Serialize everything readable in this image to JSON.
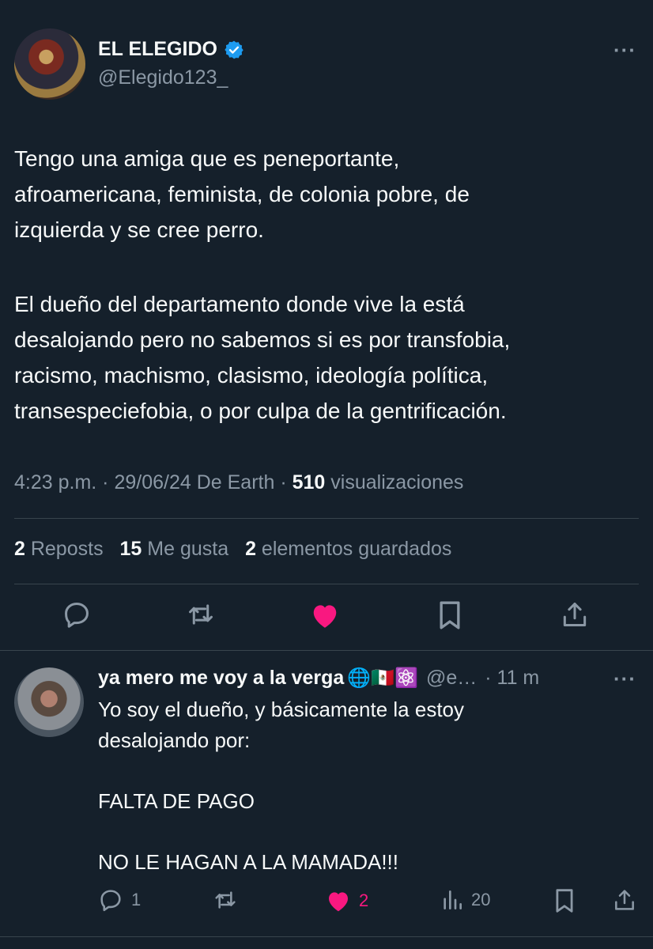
{
  "post": {
    "author_name": "EL ELEGIDO",
    "author_handle": "@Elegido123_",
    "more_label": "···",
    "paragraph_1": "Tengo una amiga que es peneportante,\nafroamericana, feminista, de colonia pobre, de\nizquierda y se cree perro.",
    "paragraph_2": "El dueño del departamento donde vive la está\ndesalojando pero no sabemos si es por transfobia,\nracismo, machismo, clasismo, ideología política,\ntransespeciefobia, o por culpa de la gentrificación.",
    "meta": {
      "time": "4:23 p.m.",
      "sep1": " · ",
      "date": "29/06/24",
      "source": " De Earth",
      "sep2": " · ",
      "views_count": "510",
      "views_label": " visualizaciones"
    },
    "stats": {
      "reposts_count": "2",
      "reposts_label": " Reposts",
      "likes_count": "15",
      "likes_label": " Me gusta",
      "bookmarks_count": "2",
      "bookmarks_label": " elementos guardados"
    },
    "actions": [
      "reply-icon",
      "repost-icon",
      "like-icon-filled",
      "bookmark-icon",
      "share-icon"
    ],
    "like_color": "#f91880"
  },
  "reply": {
    "author_name": "ya mero me voy a la verga",
    "emoji": "🌐🇲🇽⚛️",
    "handle_truncated": "@e…",
    "time": "· 11 m",
    "more_label": "···",
    "text": "Yo soy el dueño, y básicamente la estoy\ndesalojando por:\n\nFALTA DE PAGO\n\nNO LE HAGAN A LA MAMADA!!!",
    "counts": {
      "replies": "1",
      "likes": "2",
      "views": "20"
    }
  }
}
